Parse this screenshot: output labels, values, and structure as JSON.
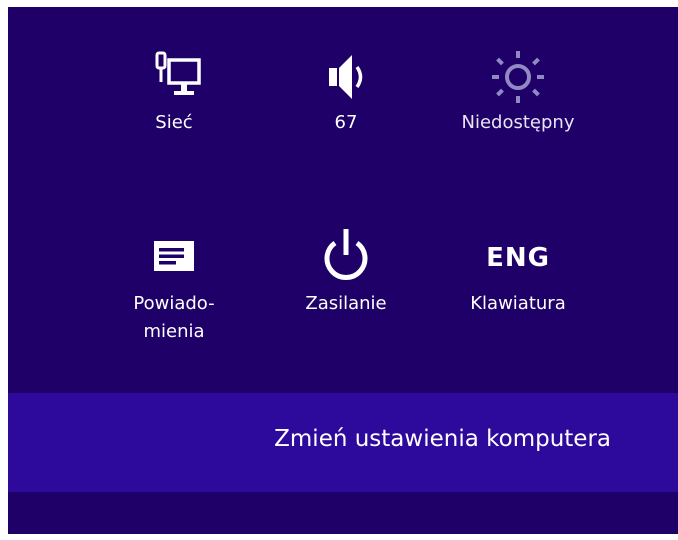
{
  "quick_settings": {
    "network": {
      "label": "Sieć",
      "icon": "network-icon"
    },
    "volume": {
      "label": "67",
      "icon": "volume-icon"
    },
    "brightness": {
      "label": "Niedostępny",
      "icon": "brightness-icon"
    },
    "notifications": {
      "label_line1": "Powiado-",
      "label_line2": "mienia",
      "icon": "notifications-icon"
    },
    "power": {
      "label": "Zasilanie",
      "icon": "power-icon"
    },
    "keyboard": {
      "label": "Klawiatura",
      "indicator": "ENG"
    }
  },
  "settings_link": {
    "label": "Zmień ustawienia komputera"
  },
  "colors": {
    "panel_bg": "#1f0068",
    "bar_bg": "#2e0a9c",
    "text": "#ffffff"
  }
}
